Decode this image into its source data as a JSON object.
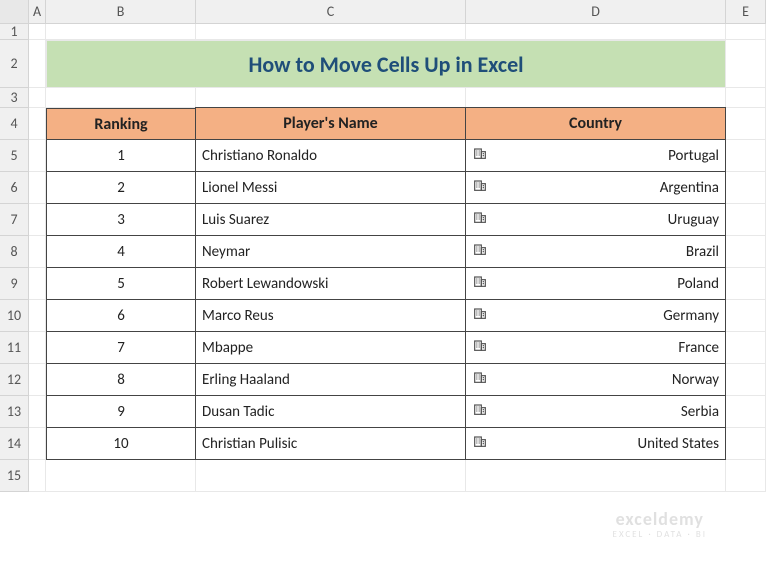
{
  "columns": [
    "A",
    "B",
    "C",
    "D",
    "E"
  ],
  "rowcount": 15,
  "title": "How to Move Cells Up in Excel",
  "headers": {
    "rank": "Ranking",
    "player": "Player's Name",
    "country": "Country"
  },
  "rows": [
    {
      "rank": "1",
      "player": "Christiano Ronaldo",
      "country": "Portugal"
    },
    {
      "rank": "2",
      "player": "Lionel Messi",
      "country": "Argentina"
    },
    {
      "rank": "3",
      "player": "Luis Suarez",
      "country": "Uruguay"
    },
    {
      "rank": "4",
      "player": "Neymar",
      "country": "Brazil"
    },
    {
      "rank": "5",
      "player": "Robert Lewandowski",
      "country": "Poland"
    },
    {
      "rank": "6",
      "player": "Marco Reus",
      "country": "Germany"
    },
    {
      "rank": "7",
      "player": "Mbappe",
      "country": "France"
    },
    {
      "rank": "8",
      "player": "Erling Haaland",
      "country": "Norway"
    },
    {
      "rank": "9",
      "player": "Dusan Tadic",
      "country": "Serbia"
    },
    {
      "rank": "10",
      "player": "Christian Pulisic",
      "country": "United States"
    }
  ],
  "watermark": {
    "top": "exceldemy",
    "bot": "EXCEL · DATA · BI"
  },
  "icon_name": "building-icon"
}
